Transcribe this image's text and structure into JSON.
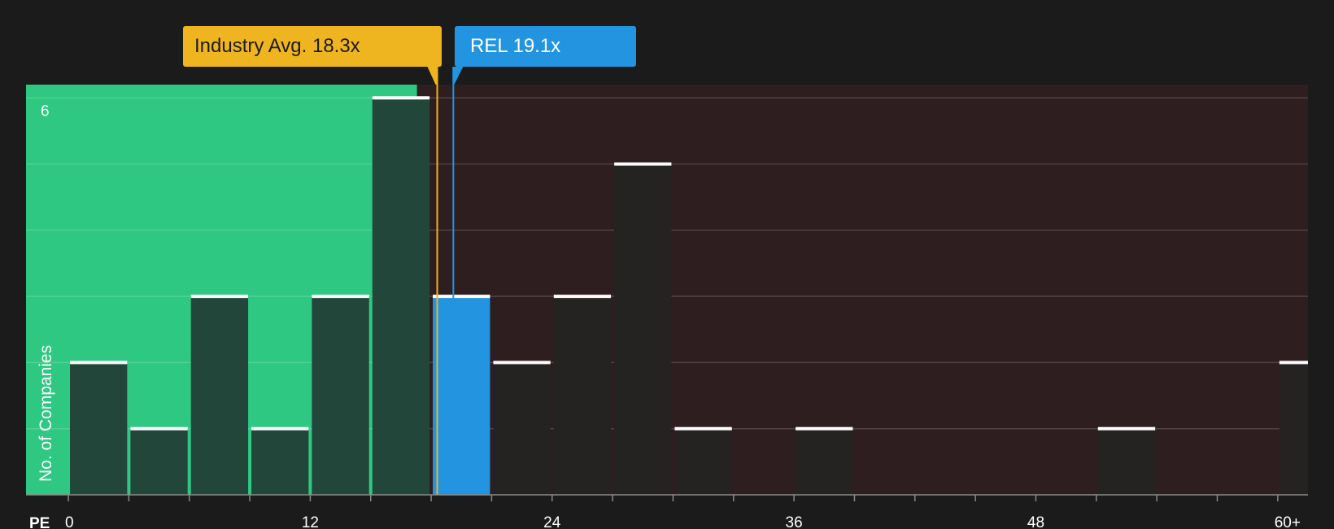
{
  "chart_data": {
    "type": "bar",
    "xlabel": "PE",
    "ylabel": "No. of Companies",
    "xlim": [
      -2.1,
      61.5
    ],
    "ylim": [
      0,
      6.2
    ],
    "x_ticks": [
      {
        "value": 0,
        "label": "0"
      },
      {
        "value": 12,
        "label": "12"
      },
      {
        "value": 24,
        "label": "24"
      },
      {
        "value": 36,
        "label": "36"
      },
      {
        "value": 48,
        "label": "48"
      },
      {
        "value": 60,
        "label": "60+"
      }
    ],
    "y_ticks": [
      {
        "value": 6,
        "label": "6"
      }
    ],
    "y_gridlines": [
      1,
      2,
      3,
      4,
      5,
      6
    ],
    "bin_width": 3,
    "bins": [
      {
        "start": 0,
        "value": 2
      },
      {
        "start": 3,
        "value": 1
      },
      {
        "start": 6,
        "value": 3
      },
      {
        "start": 9,
        "value": 1
      },
      {
        "start": 12,
        "value": 3
      },
      {
        "start": 15,
        "value": 6
      },
      {
        "start": 18,
        "value": 3,
        "highlight": true
      },
      {
        "start": 21,
        "value": 2
      },
      {
        "start": 24,
        "value": 3
      },
      {
        "start": 27,
        "value": 5
      },
      {
        "start": 30,
        "value": 1
      },
      {
        "start": 36,
        "value": 1
      },
      {
        "start": 51,
        "value": 1
      },
      {
        "start": 60,
        "value": 2
      }
    ],
    "markers": {
      "industry": {
        "label": "Industry Avg. 18.3x",
        "value": 18.3,
        "color": "#efb520"
      },
      "company": {
        "label": "REL 19.1x",
        "value": 19.1,
        "color": "#2394e0"
      }
    },
    "colors": {
      "undervalued_region": "#2ec882",
      "overvalued_region": "#2f1e1f",
      "bar_in_green": "#22473a",
      "bar_in_red": "#252222",
      "highlight_bar": "#2394e0",
      "cap": "#ffffff"
    }
  }
}
